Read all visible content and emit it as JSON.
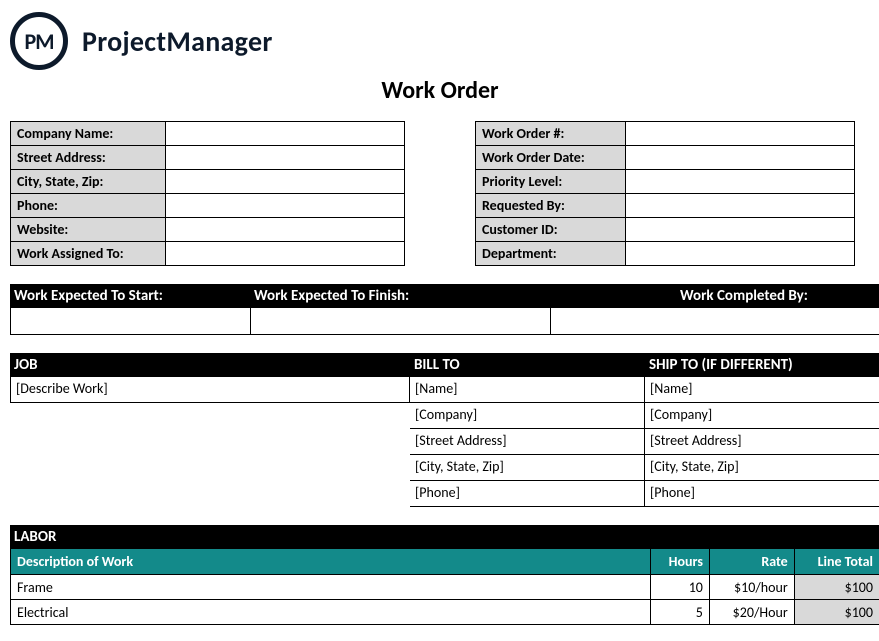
{
  "brand": {
    "logo_text": "PM",
    "name": "ProjectManager"
  },
  "title": "Work Order",
  "company_info": {
    "labels": [
      "Company Name:",
      "Street Address:",
      "City, State, Zip:",
      "Phone:",
      "Website:",
      "Work Assigned To:"
    ],
    "values": [
      "",
      "",
      "",
      "",
      "",
      ""
    ]
  },
  "order_info": {
    "labels": [
      "Work Order #:",
      "Work Order Date:",
      "Priority Level:",
      "Requested By:",
      "Customer ID:",
      "Department:"
    ],
    "values": [
      "",
      "",
      "",
      "",
      "",
      ""
    ]
  },
  "dates": {
    "headers": [
      "Work Expected To Start:",
      "Work Expected To Finish:",
      "Work Completed By:"
    ],
    "values": [
      "",
      "",
      ""
    ]
  },
  "job_section": {
    "headers": [
      "JOB",
      "BILL TO",
      "SHIP TO (IF DIFFERENT)"
    ],
    "job_desc": "[Describe Work]",
    "bill_to": [
      "[Name]",
      "[Company]",
      "[Street Address]",
      "[City, State, Zip]",
      "[Phone]"
    ],
    "ship_to": [
      "[Name]",
      "[Company]",
      "[Street Address]",
      "[City, State, Zip]",
      "[Phone]"
    ]
  },
  "labor": {
    "section_title": "LABOR",
    "columns": [
      "Description of Work",
      "Hours",
      "Rate",
      "Line Total"
    ],
    "rows": [
      {
        "desc": "Frame",
        "hours": "10",
        "rate": "$10/hour",
        "total": "$100"
      },
      {
        "desc": "Electrical",
        "hours": "5",
        "rate": "$20/Hour",
        "total": "$100"
      }
    ]
  }
}
